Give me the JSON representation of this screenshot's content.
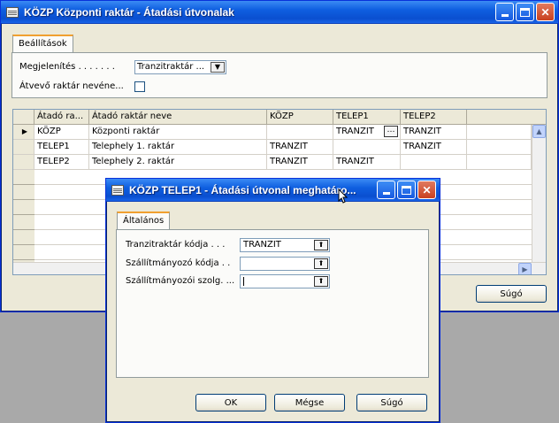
{
  "main_window": {
    "title": "KÖZP Központi raktár - Átadási útvonalak",
    "tab": "Beállítások",
    "display_label": "Megjelenítés . . . . . . .",
    "display_value": "Tranzitraktár ...",
    "show_receiver_label": "Átvevő raktár nevéne...",
    "grid": {
      "headers": [
        "Átadó ra...",
        "Átadó raktár neve",
        "KÖZP",
        "TELEP1",
        "TELEP2"
      ],
      "rows": [
        {
          "code": "KÖZP",
          "name": "Központi raktár",
          "kozp": "",
          "telep1": "TRANZIT",
          "telep2": "TRANZIT"
        },
        {
          "code": "TELEP1",
          "name": "Telephely 1. raktár",
          "kozp": "TRANZIT",
          "telep1": "",
          "telep2": "TRANZIT"
        },
        {
          "code": "TELEP2",
          "name": "Telephely 2. raktár",
          "kozp": "TRANZIT",
          "telep1": "TRANZIT",
          "telep2": ""
        }
      ]
    },
    "help_button": "Súgó"
  },
  "dialog": {
    "title": "KÖZP TELEP1 - Átadási útvonal meghatáro...",
    "tab": "Általános",
    "fields": [
      {
        "label": "Tranzitraktár kódja . . .",
        "value": "TRANZIT"
      },
      {
        "label": "Szállítmányozó kódja . .",
        "value": ""
      },
      {
        "label": "Szállítmányozói szolg. ...",
        "value": ""
      }
    ],
    "ok_button": "OK",
    "cancel_button": "Mégse",
    "help_button": "Súgó"
  },
  "icons": {
    "lookup": "ellipsis-icon",
    "dropdown": "chevron-down-icon",
    "up": "arrow-up-icon"
  }
}
